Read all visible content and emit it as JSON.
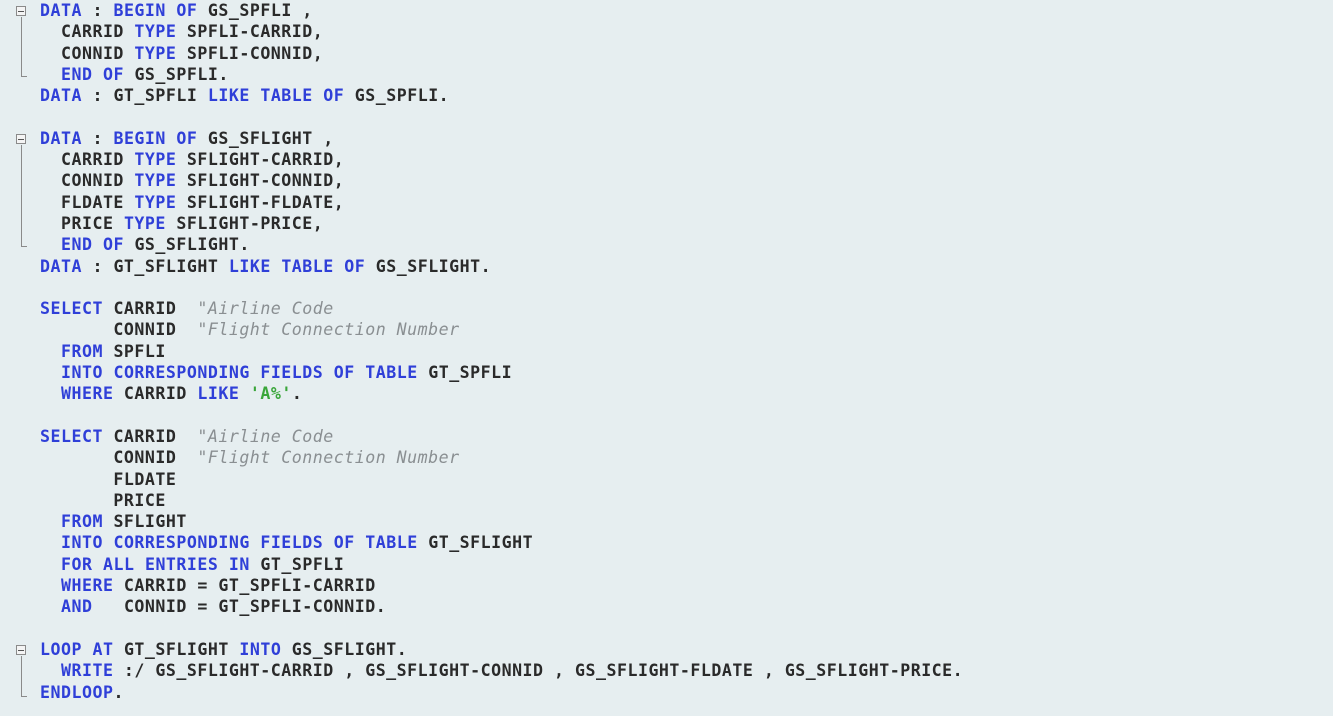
{
  "editor": {
    "language": "ABAP",
    "colors": {
      "background": "#e6eef0",
      "keyword": "#2f3fd8",
      "identifier": "#2a2a2a",
      "comment": "#8a8f92",
      "string": "#3aa63a",
      "fold_marker": "#8a8a8a"
    },
    "lines": [
      [
        {
          "t": "kw",
          "v": "DATA"
        },
        {
          "t": "pn",
          "v": " : "
        },
        {
          "t": "kw",
          "v": "BEGIN"
        },
        {
          "t": "pn",
          "v": " "
        },
        {
          "t": "kw",
          "v": "OF"
        },
        {
          "t": "pn",
          "v": " GS_SPFLI ,"
        }
      ],
      [
        {
          "t": "pn",
          "v": "  CARRID "
        },
        {
          "t": "kw",
          "v": "TYPE"
        },
        {
          "t": "pn",
          "v": " SPFLI-CARRID,"
        }
      ],
      [
        {
          "t": "pn",
          "v": "  CONNID "
        },
        {
          "t": "kw",
          "v": "TYPE"
        },
        {
          "t": "pn",
          "v": " SPFLI-CONNID,"
        }
      ],
      [
        {
          "t": "pn",
          "v": "  "
        },
        {
          "t": "kw",
          "v": "END"
        },
        {
          "t": "pn",
          "v": " "
        },
        {
          "t": "kw",
          "v": "OF"
        },
        {
          "t": "pn",
          "v": " GS_SPFLI."
        }
      ],
      [
        {
          "t": "kw",
          "v": "DATA"
        },
        {
          "t": "pn",
          "v": " : GT_SPFLI "
        },
        {
          "t": "kw",
          "v": "LIKE"
        },
        {
          "t": "pn",
          "v": " "
        },
        {
          "t": "kw",
          "v": "TABLE"
        },
        {
          "t": "pn",
          "v": " "
        },
        {
          "t": "kw",
          "v": "OF"
        },
        {
          "t": "pn",
          "v": " GS_SPFLI."
        }
      ],
      [],
      [
        {
          "t": "kw",
          "v": "DATA"
        },
        {
          "t": "pn",
          "v": " : "
        },
        {
          "t": "kw",
          "v": "BEGIN"
        },
        {
          "t": "pn",
          "v": " "
        },
        {
          "t": "kw",
          "v": "OF"
        },
        {
          "t": "pn",
          "v": " GS_SFLIGHT ,"
        }
      ],
      [
        {
          "t": "pn",
          "v": "  CARRID "
        },
        {
          "t": "kw",
          "v": "TYPE"
        },
        {
          "t": "pn",
          "v": " SFLIGHT-CARRID,"
        }
      ],
      [
        {
          "t": "pn",
          "v": "  CONNID "
        },
        {
          "t": "kw",
          "v": "TYPE"
        },
        {
          "t": "pn",
          "v": " SFLIGHT-CONNID,"
        }
      ],
      [
        {
          "t": "pn",
          "v": "  FLDATE "
        },
        {
          "t": "kw",
          "v": "TYPE"
        },
        {
          "t": "pn",
          "v": " SFLIGHT-FLDATE,"
        }
      ],
      [
        {
          "t": "pn",
          "v": "  PRICE "
        },
        {
          "t": "kw",
          "v": "TYPE"
        },
        {
          "t": "pn",
          "v": " SFLIGHT-PRICE,"
        }
      ],
      [
        {
          "t": "pn",
          "v": "  "
        },
        {
          "t": "kw",
          "v": "END"
        },
        {
          "t": "pn",
          "v": " "
        },
        {
          "t": "kw",
          "v": "OF"
        },
        {
          "t": "pn",
          "v": " GS_SFLIGHT."
        }
      ],
      [
        {
          "t": "kw",
          "v": "DATA"
        },
        {
          "t": "pn",
          "v": " : GT_SFLIGHT "
        },
        {
          "t": "kw",
          "v": "LIKE"
        },
        {
          "t": "pn",
          "v": " "
        },
        {
          "t": "kw",
          "v": "TABLE"
        },
        {
          "t": "pn",
          "v": " "
        },
        {
          "t": "kw",
          "v": "OF"
        },
        {
          "t": "pn",
          "v": " GS_SFLIGHT."
        }
      ],
      [],
      [
        {
          "t": "kw",
          "v": "SELECT"
        },
        {
          "t": "pn",
          "v": " CARRID  "
        },
        {
          "t": "cm",
          "v": "\"Airline Code"
        }
      ],
      [
        {
          "t": "pn",
          "v": "       CONNID  "
        },
        {
          "t": "cm",
          "v": "\"Flight Connection Number"
        }
      ],
      [
        {
          "t": "pn",
          "v": "  "
        },
        {
          "t": "kw",
          "v": "FROM"
        },
        {
          "t": "pn",
          "v": " SPFLI"
        }
      ],
      [
        {
          "t": "pn",
          "v": "  "
        },
        {
          "t": "kw",
          "v": "INTO"
        },
        {
          "t": "pn",
          "v": " "
        },
        {
          "t": "kw",
          "v": "CORRESPONDING"
        },
        {
          "t": "pn",
          "v": " "
        },
        {
          "t": "kw",
          "v": "FIELDS"
        },
        {
          "t": "pn",
          "v": " "
        },
        {
          "t": "kw",
          "v": "OF"
        },
        {
          "t": "pn",
          "v": " "
        },
        {
          "t": "kw",
          "v": "TABLE"
        },
        {
          "t": "pn",
          "v": " GT_SPFLI"
        }
      ],
      [
        {
          "t": "pn",
          "v": "  "
        },
        {
          "t": "kw",
          "v": "WHERE"
        },
        {
          "t": "pn",
          "v": " CARRID "
        },
        {
          "t": "kw",
          "v": "LIKE"
        },
        {
          "t": "pn",
          "v": " "
        },
        {
          "t": "str",
          "v": "'A%'"
        },
        {
          "t": "pn",
          "v": "."
        }
      ],
      [],
      [
        {
          "t": "kw",
          "v": "SELECT"
        },
        {
          "t": "pn",
          "v": " CARRID  "
        },
        {
          "t": "cm",
          "v": "\"Airline Code"
        }
      ],
      [
        {
          "t": "pn",
          "v": "       CONNID  "
        },
        {
          "t": "cm",
          "v": "\"Flight Connection Number"
        }
      ],
      [
        {
          "t": "pn",
          "v": "       FLDATE"
        }
      ],
      [
        {
          "t": "pn",
          "v": "       PRICE"
        }
      ],
      [
        {
          "t": "pn",
          "v": "  "
        },
        {
          "t": "kw",
          "v": "FROM"
        },
        {
          "t": "pn",
          "v": " SFLIGHT"
        }
      ],
      [
        {
          "t": "pn",
          "v": "  "
        },
        {
          "t": "kw",
          "v": "INTO"
        },
        {
          "t": "pn",
          "v": " "
        },
        {
          "t": "kw",
          "v": "CORRESPONDING"
        },
        {
          "t": "pn",
          "v": " "
        },
        {
          "t": "kw",
          "v": "FIELDS"
        },
        {
          "t": "pn",
          "v": " "
        },
        {
          "t": "kw",
          "v": "OF"
        },
        {
          "t": "pn",
          "v": " "
        },
        {
          "t": "kw",
          "v": "TABLE"
        },
        {
          "t": "pn",
          "v": " GT_SFLIGHT"
        }
      ],
      [
        {
          "t": "pn",
          "v": "  "
        },
        {
          "t": "kw",
          "v": "FOR"
        },
        {
          "t": "pn",
          "v": " "
        },
        {
          "t": "kw",
          "v": "ALL"
        },
        {
          "t": "pn",
          "v": " "
        },
        {
          "t": "kw",
          "v": "ENTRIES"
        },
        {
          "t": "pn",
          "v": " "
        },
        {
          "t": "kw",
          "v": "IN"
        },
        {
          "t": "pn",
          "v": " GT_SPFLI"
        }
      ],
      [
        {
          "t": "pn",
          "v": "  "
        },
        {
          "t": "kw",
          "v": "WHERE"
        },
        {
          "t": "pn",
          "v": " CARRID = GT_SPFLI-CARRID"
        }
      ],
      [
        {
          "t": "pn",
          "v": "  "
        },
        {
          "t": "kw",
          "v": "AND"
        },
        {
          "t": "pn",
          "v": "   CONNID = GT_SPFLI-CONNID."
        }
      ],
      [],
      [
        {
          "t": "kw",
          "v": "LOOP"
        },
        {
          "t": "pn",
          "v": " "
        },
        {
          "t": "kw",
          "v": "AT"
        },
        {
          "t": "pn",
          "v": " GT_SFLIGHT "
        },
        {
          "t": "kw",
          "v": "INTO"
        },
        {
          "t": "pn",
          "v": " GS_SFLIGHT."
        }
      ],
      [
        {
          "t": "pn",
          "v": "  "
        },
        {
          "t": "kw",
          "v": "WRITE"
        },
        {
          "t": "pn",
          "v": " :/ GS_SFLIGHT-CARRID , GS_SFLIGHT-CONNID , GS_SFLIGHT-FLDATE , GS_SFLIGHT-PRICE."
        }
      ],
      [
        {
          "t": "kw",
          "v": "ENDLOOP"
        },
        {
          "t": "pn",
          "v": "."
        }
      ]
    ]
  }
}
